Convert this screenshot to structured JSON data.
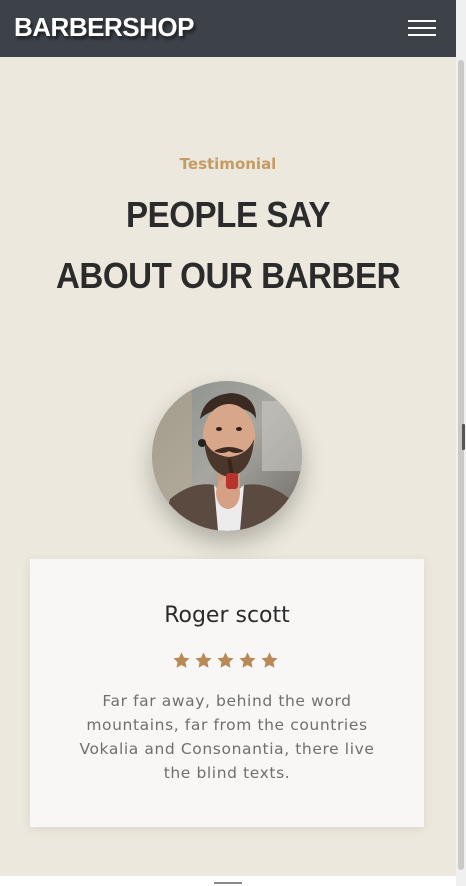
{
  "navbar": {
    "brand": "BARBERSHOP",
    "menu_icon": "hamburger-menu-icon"
  },
  "testimonial": {
    "subheading": "Testimonial",
    "title_line1": "PEOPLE SAY",
    "title_line2": "ABOUT OUR BARBER"
  },
  "review": {
    "avatar_alt": "bearded man smoking a pipe",
    "name": "Roger scott",
    "rating": 5,
    "rating_max": 5,
    "text": "Far far away, behind the word mountains, far from the countries Vokalia and Consonantia, there live the blind texts."
  },
  "colors": {
    "background": "#ece8dd",
    "navbar": "#3d4249",
    "accent": "#c49b63",
    "heading": "#2b2b2b",
    "card": "#f8f7f6",
    "body_text": "#6f6f6f"
  }
}
